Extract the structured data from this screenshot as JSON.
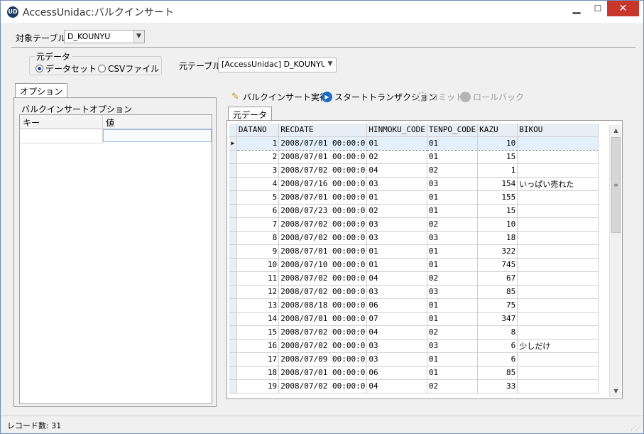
{
  "window": {
    "title": "AccessUnidac:バルクインサート",
    "icon_text": "UD",
    "minimize": "▁",
    "maximize": "☐",
    "close": "✕"
  },
  "target_table": {
    "label": "対象テーブル",
    "value": "D_KOUNYU"
  },
  "source_group": {
    "legend": "元データ",
    "options": [
      {
        "label": "データセット",
        "selected": true
      },
      {
        "label": "CSVファイル",
        "selected": false
      }
    ]
  },
  "source_table": {
    "label": "元テーブル",
    "value": "[AccessUnidac] D_KOUNYU"
  },
  "options_tab": {
    "label": "オプション",
    "section_title": "バルクインサートオプション",
    "columns": [
      "キー",
      "値"
    ]
  },
  "toolbar": {
    "bulk_insert": "バルクインサート実行",
    "start_transaction": "スタートトランザクション",
    "commit": "コミット",
    "rollback": "ロールバック"
  },
  "data_tab": {
    "label": "元データ"
  },
  "grid": {
    "columns": [
      "DATANO",
      "RECDATE",
      "HINMOKU_CODE",
      "TENPO_CODE",
      "KAZU",
      "BIKOU"
    ],
    "rows": [
      [
        "1",
        "2008/07/01 00:00:0",
        "01",
        "01",
        "10",
        ""
      ],
      [
        "2",
        "2008/07/01 00:00:0",
        "02",
        "01",
        "15",
        ""
      ],
      [
        "3",
        "2008/07/02 00:00:0",
        "04",
        "02",
        "1",
        ""
      ],
      [
        "4",
        "2008/07/16 00:00:0",
        "03",
        "03",
        "154",
        "いっぱい売れた"
      ],
      [
        "5",
        "2008/07/01 00:00:0",
        "01",
        "01",
        "155",
        ""
      ],
      [
        "6",
        "2008/07/23 00:00:0",
        "02",
        "01",
        "15",
        ""
      ],
      [
        "7",
        "2008/07/02 00:00:0",
        "03",
        "02",
        "10",
        ""
      ],
      [
        "8",
        "2008/07/02 00:00:0",
        "03",
        "03",
        "18",
        ""
      ],
      [
        "9",
        "2008/07/01 00:00:0",
        "01",
        "01",
        "322",
        ""
      ],
      [
        "10",
        "2008/07/10 00:00:0",
        "01",
        "01",
        "745",
        ""
      ],
      [
        "11",
        "2008/07/02 00:00:0",
        "04",
        "02",
        "67",
        ""
      ],
      [
        "12",
        "2008/07/02 00:00:0",
        "03",
        "03",
        "85",
        ""
      ],
      [
        "13",
        "2008/08/18 00:00:0",
        "06",
        "01",
        "75",
        ""
      ],
      [
        "14",
        "2008/07/01 00:00:0",
        "07",
        "01",
        "347",
        ""
      ],
      [
        "15",
        "2008/07/02 00:00:0",
        "04",
        "02",
        "8",
        ""
      ],
      [
        "16",
        "2008/07/02 00:00:0",
        "03",
        "03",
        "6",
        "少しだけ"
      ],
      [
        "17",
        "2008/07/09 00:00:0",
        "03",
        "01",
        "6",
        ""
      ],
      [
        "18",
        "2008/07/01 00:00:0",
        "06",
        "01",
        "85",
        ""
      ],
      [
        "19",
        "2008/07/02 00:00:0",
        "04",
        "02",
        "33",
        ""
      ]
    ],
    "selected_row_index": 0,
    "scrollbar_grip": "≡"
  },
  "status": {
    "record_count": "レコード数: 31"
  },
  "colors": {
    "close_button": "#c7372b",
    "grid_header": "#e8eef6",
    "selection": "#e3f0fb"
  }
}
